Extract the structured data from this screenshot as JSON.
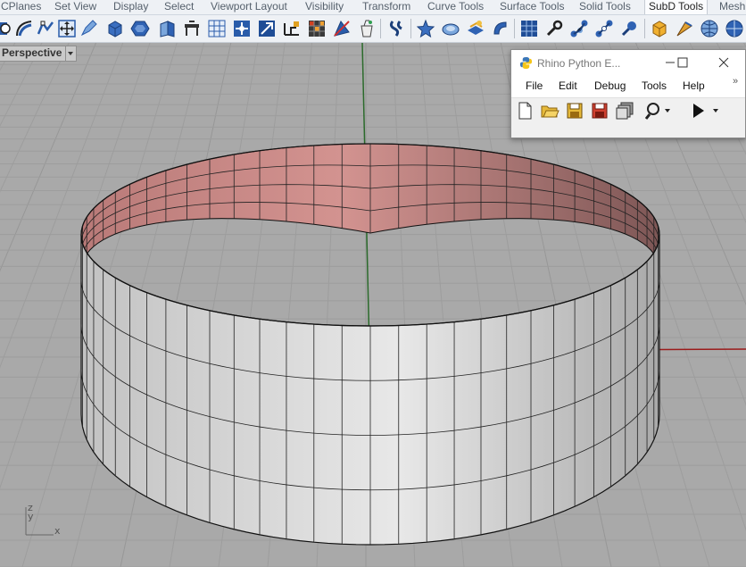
{
  "tabs": [
    {
      "label": "CPlanes",
      "active": false
    },
    {
      "label": "Set View",
      "active": false
    },
    {
      "label": "Display",
      "active": false
    },
    {
      "label": "Select",
      "active": false
    },
    {
      "label": "Viewport Layout",
      "active": false
    },
    {
      "label": "Visibility",
      "active": false
    },
    {
      "label": "Transform",
      "active": false
    },
    {
      "label": "Curve Tools",
      "active": false
    },
    {
      "label": "Surface Tools",
      "active": false
    },
    {
      "label": "Solid Tools",
      "active": false
    },
    {
      "label": "SubD Tools",
      "active": true
    },
    {
      "label": "Mesh",
      "active": false
    }
  ],
  "toolbar_icons": [
    "rotate-view-icon",
    "curve-from-objects-icon",
    "transform-icon",
    "edit-curve-icon",
    "box-icon",
    "polygon-icon",
    "extrude-surface-icon",
    "render-table-icon",
    "mesh-grid-icon",
    "navigation-icon",
    "move-gumball-icon",
    "dimension-icon",
    "texture-grid-icon",
    "drafting-icon",
    "layer-bucket-icon",
    "dimension-snap-icon",
    "star-icon",
    "blob-icon",
    "surface-layers-icon",
    "boolean-icon",
    "subd-grid-icon",
    "wrench-icon",
    "nodes-icon",
    "nodes-alt-icon",
    "wrench-blue-icon",
    "subd-box-icon",
    "rocket-icon",
    "globe-icon",
    "globe-alt-icon"
  ],
  "viewport": {
    "title": "Perspective",
    "axis_labels": {
      "x": "x",
      "y": "y",
      "z": "z"
    }
  },
  "python_editor": {
    "title": "Rhino Python E...",
    "menu": [
      "File",
      "Edit",
      "Debug",
      "Tools",
      "Help"
    ],
    "overflow_label": "»",
    "tool_icons": [
      "new-file-icon",
      "open-folder-icon",
      "save-icon",
      "save-as-icon",
      "save-all-icon",
      "search-icon",
      "run-icon",
      "dropdown-arrow-icon"
    ]
  },
  "colors": {
    "background": "#a9a9a9",
    "surface_inner": "#d39390",
    "surface_outer": "#d9d9d9",
    "x_axis": "#9b1b1b",
    "y_axis": "#2b6a2b",
    "accent_tab": "#fbfcfe"
  }
}
